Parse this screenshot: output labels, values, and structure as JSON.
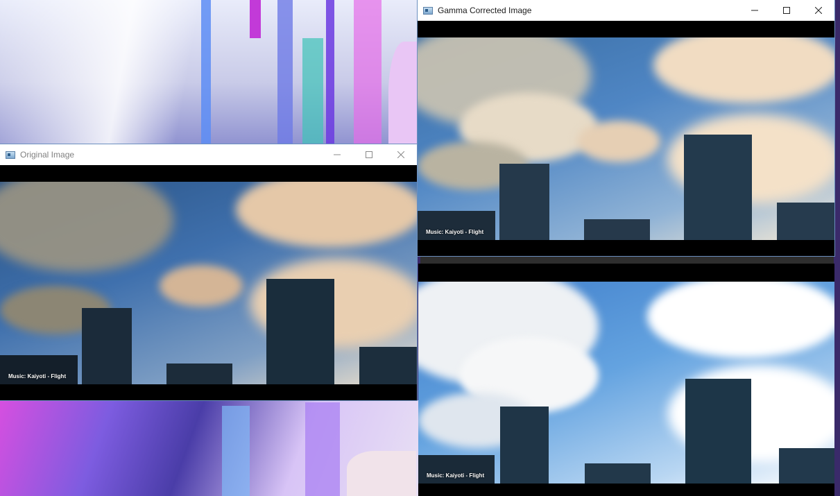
{
  "windows": {
    "original": {
      "title": "Original Image",
      "caption": "Music: Kaiyoti - Flight"
    },
    "gamma": {
      "title": "Gamma Corrected Image",
      "caption": "Music: Kaiyoti - Flight"
    },
    "third": {
      "title": "",
      "caption": "Music: Kaiyoti - Flight"
    }
  },
  "icons": [
    "app-icon",
    "minimize-icon",
    "maximize-icon",
    "close-icon"
  ],
  "colors": {
    "titlebar_bg": "#ffffff",
    "window_border_active": "#6b8fbf",
    "letterbox": "#000000",
    "sky_dark": "#2f5e95",
    "sky_bright": "#5f97d6",
    "cloud_warm": "#e8c9a8",
    "cloud_bright": "#f4f2ee"
  }
}
